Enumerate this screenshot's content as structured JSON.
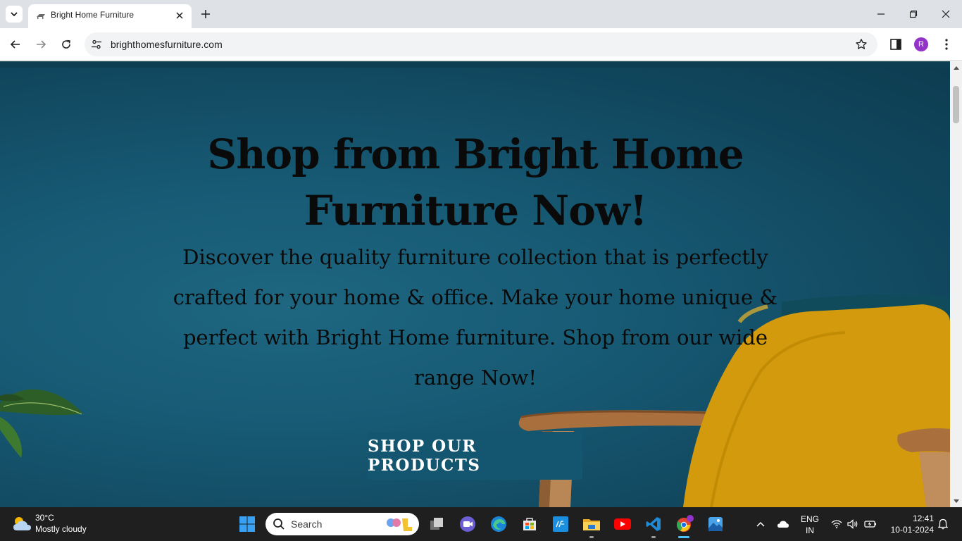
{
  "browser": {
    "tab": {
      "title": "Bright Home Furniture"
    },
    "address_bar": {
      "url": "brighthomesfurniture.com"
    },
    "profile_initial": "R"
  },
  "page": {
    "hero": {
      "title_line1": "Shop from Bright Home",
      "title_line2": "Furniture Now!",
      "description": "Discover the quality furniture collection that is perfectly crafted for your home & office. Make your home unique & perfect with Bright Home furniture. Shop from our wide range Now!",
      "cta_label": "SHOP OUR PRODUCTS"
    },
    "colors": {
      "hero_background": "#175a74",
      "cta_background": "#14566f",
      "cushion": "#d29a0c",
      "chair_wood": "#a9703e"
    }
  },
  "taskbar": {
    "weather": {
      "temp": "30°C",
      "condition": "Mostly cloudy"
    },
    "search_placeholder": "Search",
    "pinned_apps": [
      "windows-start",
      "task-view",
      "meet",
      "edge",
      "microsoft-store",
      "myhp",
      "file-explorer",
      "youtube",
      "vscode",
      "chrome",
      "photos"
    ],
    "tray": {
      "language": "ENG",
      "region": "IN",
      "time": "12:41",
      "date": "10-01-2024"
    }
  }
}
